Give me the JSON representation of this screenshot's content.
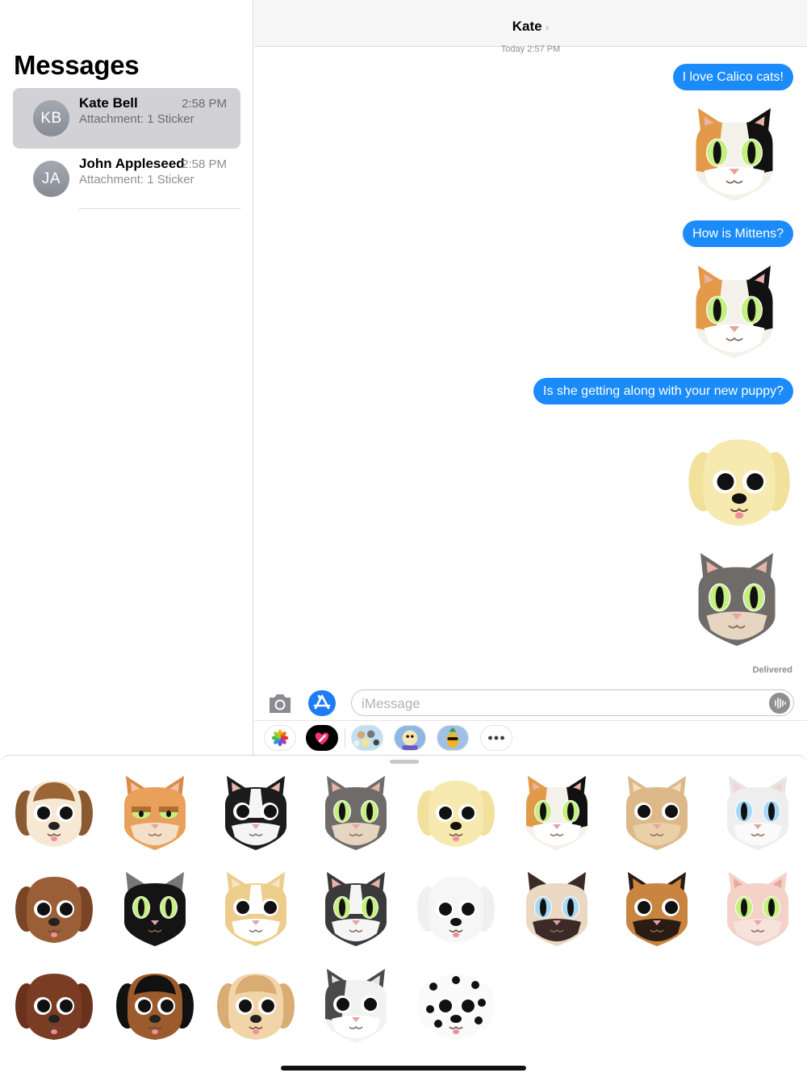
{
  "sidebar": {
    "title": "Messages",
    "conversations": [
      {
        "initials": "KB",
        "name": "Kate Bell",
        "time": "2:58 PM",
        "preview": "Attachment: 1 Sticker"
      },
      {
        "initials": "JA",
        "name": "John Appleseed",
        "time": "2:58 PM",
        "preview": "Attachment: 1 Sticker"
      }
    ]
  },
  "chat": {
    "contact": "Kate",
    "timestamp_day": "Today",
    "timestamp_time": "2:57 PM",
    "messages": [
      "I love Calico cats!",
      "How is Mittens?",
      "Is she getting along with your new puppy?"
    ],
    "stickers_in_chat": [
      "calico-cat-sticker",
      "calico-cat-sticker",
      "golden-puppy-sticker",
      "tabby-cat-sticker"
    ],
    "delivered": "Delivered",
    "input_placeholder": "iMessage"
  },
  "app_drawer": [
    "photos-app-icon",
    "digital-touch-app-icon",
    "sticker-pack-cats-dogs-icon",
    "sticker-pack-puppy-icon",
    "sticker-pack-pineapple-icon",
    "more-apps-icon"
  ],
  "sticker_grid": [
    [
      "beagle",
      "orange-tabby-cat",
      "boston-terrier",
      "gray-tabby-cat",
      "golden-puppy",
      "calico-cat",
      "chihuahua",
      "white-cat"
    ],
    [
      "brown-dog",
      "black-cat",
      "corgi",
      "tuxedo-cat",
      "white-fluffy-dog",
      "siamese-cat",
      "german-shepherd",
      "pink-cat"
    ],
    [
      "chocolate-poodle",
      "black-tan-dog",
      "cocker-spaniel",
      "husky",
      "dalmatian"
    ]
  ],
  "colors": {
    "bubble_blue": "#1b8bfa",
    "selection_gray": "#d1d1d6",
    "secondary_text": "#8e8e93"
  }
}
